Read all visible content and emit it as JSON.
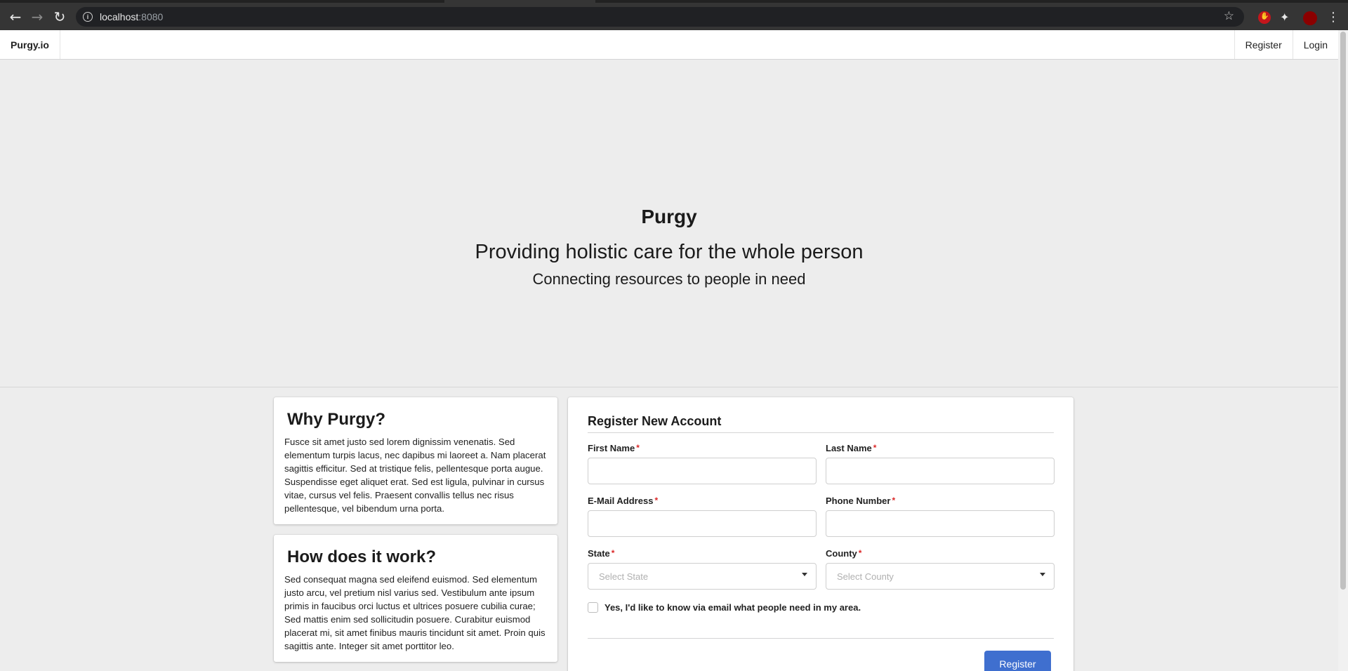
{
  "browser": {
    "url_host": "localhost",
    "url_port": ":8080",
    "icons": {
      "back": "back-arrow-icon",
      "forward": "forward-arrow-icon",
      "reload": "reload-icon",
      "info": "info-icon",
      "star": "star-icon",
      "extension_stop": "stop-extension-icon",
      "extensions": "puzzle-icon",
      "profile": "profile-avatar",
      "menu": "kebab-menu-icon"
    }
  },
  "nav": {
    "brand": "Purgy.io",
    "register": "Register",
    "login": "Login"
  },
  "hero": {
    "title": "Purgy",
    "subtitle": "Providing holistic care for the whole person",
    "tagline": "Connecting resources to people in need"
  },
  "why": {
    "title": "Why Purgy?",
    "body": "Fusce sit amet justo sed lorem dignissim venenatis. Sed elementum turpis lacus, nec dapibus mi laoreet a. Nam placerat sagittis efficitur. Sed at tristique felis, pellentesque porta augue. Suspendisse eget aliquet erat. Sed est ligula, pulvinar in cursus vitae, cursus vel felis. Praesent convallis tellus nec risus pellentesque, vel bibendum urna porta."
  },
  "how": {
    "title": "How does it work?",
    "body": "Sed consequat magna sed eleifend euismod. Sed elementum justo arcu, vel pretium nisl varius sed. Vestibulum ante ipsum primis in faucibus orci luctus et ultrices posuere cubilia curae; Sed mattis enim sed sollicitudin posuere. Curabitur euismod placerat mi, sit amet finibus mauris tincidunt sit amet. Proin quis sagittis ante. Integer sit amet porttitor leo."
  },
  "form": {
    "title": "Register New Account",
    "required_marker": "*",
    "first_name_label": "First Name",
    "first_name_value": "",
    "last_name_label": "Last Name",
    "last_name_value": "",
    "email_label": "E-Mail Address",
    "email_value": "",
    "phone_label": "Phone Number",
    "phone_value": "",
    "state_label": "State",
    "state_placeholder": "Select State",
    "county_label": "County",
    "county_placeholder": "Select County",
    "notify_label": "Yes, I'd like to know via email what people need in my area.",
    "notify_checked": false,
    "submit_label": "Register"
  },
  "colors": {
    "accent": "#3f6fcf",
    "required": "#db2828",
    "hero_bg": "#ededed",
    "browser_bar": "#353535"
  }
}
